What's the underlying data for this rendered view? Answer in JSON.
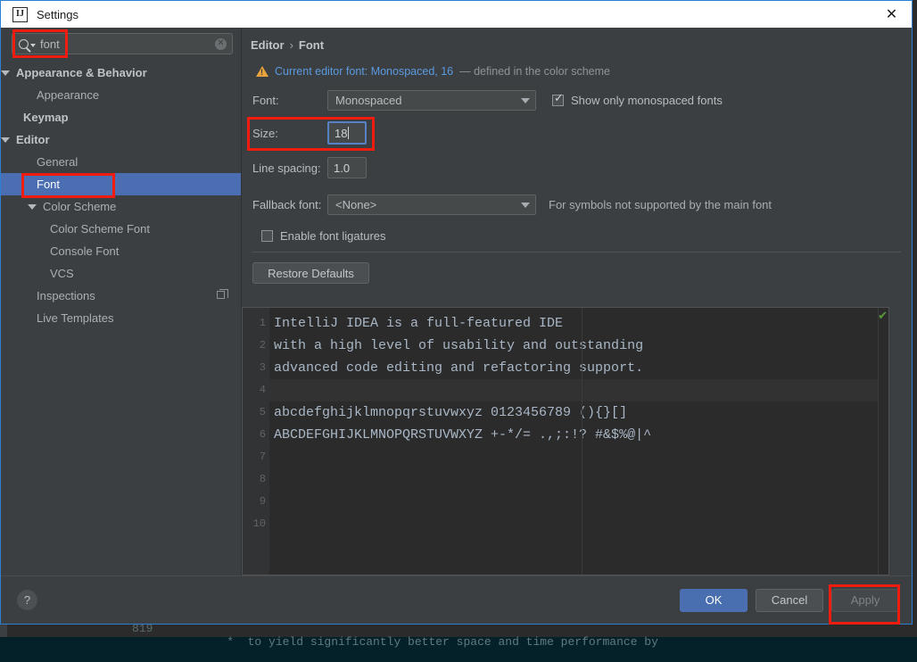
{
  "window": {
    "title": "Settings",
    "app_icon": "intellij-idea-icon",
    "close_label": "✕"
  },
  "search": {
    "value": "font",
    "icon": "search-icon",
    "clear_icon": "clear-icon",
    "clear_label": "✕"
  },
  "sidebar": {
    "items": [
      {
        "label": "Appearance & Behavior",
        "indent": 10,
        "bold": true,
        "twisty": true,
        "selected": false
      },
      {
        "label": "Appearance",
        "indent": 40,
        "bold": false,
        "twisty": false,
        "selected": false
      },
      {
        "label": "Keymap",
        "indent": 25,
        "bold": true,
        "twisty": false,
        "selected": false
      },
      {
        "label": "Editor",
        "indent": 10,
        "bold": true,
        "twisty": true,
        "selected": false
      },
      {
        "label": "General",
        "indent": 40,
        "bold": false,
        "twisty": false,
        "selected": false
      },
      {
        "label": "Font",
        "indent": 40,
        "bold": false,
        "twisty": false,
        "selected": true
      },
      {
        "label": "Color Scheme",
        "indent": 40,
        "bold": false,
        "twisty": true,
        "selected": false
      },
      {
        "label": "Color Scheme Font",
        "indent": 55,
        "bold": false,
        "twisty": false,
        "selected": false
      },
      {
        "label": "Console Font",
        "indent": 55,
        "bold": false,
        "twisty": false,
        "selected": false
      },
      {
        "label": "VCS",
        "indent": 55,
        "bold": false,
        "twisty": false,
        "selected": false
      },
      {
        "label": "Inspections",
        "indent": 40,
        "bold": false,
        "twisty": false,
        "selected": false,
        "trailing_icon": "copy-icon"
      },
      {
        "label": "Live Templates",
        "indent": 40,
        "bold": false,
        "twisty": false,
        "selected": false
      }
    ]
  },
  "breadcrumb": {
    "root": "Editor",
    "separator": "›",
    "leaf": "Font"
  },
  "warning": {
    "icon": "warning-triangle-icon",
    "link": "Current editor font: Monospaced, 16",
    "note": "— defined in the color scheme"
  },
  "form": {
    "font_label": "Font:",
    "font_value": "Monospaced",
    "show_monospaced_label": "Show only monospaced fonts",
    "show_monospaced_checked": true,
    "size_label": "Size:",
    "size_value": "18",
    "line_spacing_label": "Line spacing:",
    "line_spacing_value": "1.0",
    "fallback_label": "Fallback font:",
    "fallback_value": "<None>",
    "fallback_note": "For symbols not supported by the main font",
    "ligatures_label": "Enable font ligatures",
    "ligatures_checked": false,
    "restore_defaults_label": "Restore Defaults"
  },
  "preview": {
    "line_numbers": [
      "1",
      "2",
      "3",
      "4",
      "5",
      "6",
      "7",
      "8",
      "9",
      "10"
    ],
    "lines": [
      "IntelliJ IDEA is a full-featured IDE",
      "with a high level of usability and outstanding",
      "advanced code editing and refactoring support.",
      "",
      "abcdefghijklmnopqrstuvwxyz 0123456789 (){}[]",
      "ABCDEFGHIJKLMNOPQRSTUVWXYZ +-*/= .,;:!? #&$%@|^",
      "",
      "",
      "",
      ""
    ],
    "status_icon": "ok-check-icon",
    "status_glyph": "✔"
  },
  "footer": {
    "help_label": "?",
    "ok_label": "OK",
    "cancel_label": "Cancel",
    "apply_label": "Apply"
  },
  "background": {
    "gutter_number": "819",
    "code_text": "*  to yield significantly better space and time performance by"
  },
  "colors": {
    "accent_blue": "#4b6eb3",
    "dialog_border": "#2b7fd4",
    "annotation_red": "#f01c10",
    "warning_orange": "#e8a33d",
    "link_blue": "#5a9ae0",
    "panel_bg": "#3c3f41",
    "editor_bg": "#2b2b2b"
  }
}
